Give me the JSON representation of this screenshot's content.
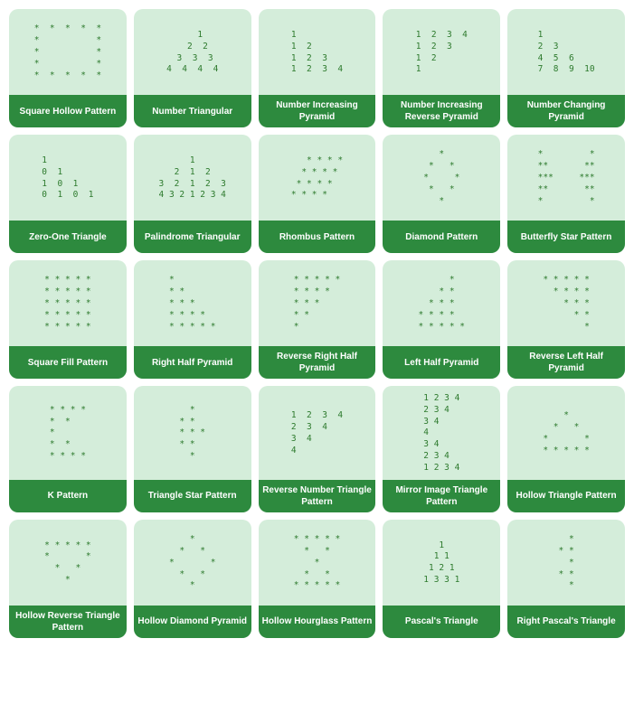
{
  "cards": [
    {
      "label": "Square Hollow\nPattern",
      "content": "*  *  *  *  *\n*              *\n*              *\n*              *\n*  *  *  *  *"
    },
    {
      "label": "Number\nTriangular",
      "content": "        1\n      2  2\n    3  3  3\n  4  4  4  4"
    },
    {
      "label": "Number\nIncreasing\nPyramid",
      "content": "1\n1  2\n1  2  3\n1  2  3  4"
    },
    {
      "label": "Number\nIncreasing\nReverse Pyramid",
      "content": "1  2  3  4\n1  2  3\n1  2\n1"
    },
    {
      "label": "Number\nChanging\nPyramid",
      "content": "1\n2  3\n4  5  6\n7  8  9  10"
    },
    {
      "label": "Zero-One\nTriangle",
      "content": "1\n0  1\n1  0  1\n0  1  0  1"
    },
    {
      "label": "Palindrome\nTriangular",
      "content": "         1\n      2  1  2\n   3  2  1  2  3\n4  3  2  1  2  3  4"
    },
    {
      "label": "Rhombus Pattern",
      "content": "   *  *  *  *\n  *  *  *  *\n *  *  *  *\n*  *  *  *"
    },
    {
      "label": "Diamond Pattern",
      "content": "    *\n  *    *\n*        *\n  *    *\n    *"
    },
    {
      "label": "Butterfly\nStar Pattern",
      "content": "*              *\n* *          * *\n* * *      * * *\n* *          * *\n*              *"
    },
    {
      "label": "Square Fill\nPattern",
      "content": "* * * * *\n* * * * *\n* * * * *\n* * * * *\n* * * * *"
    },
    {
      "label": "Right Half\nPyramid",
      "content": "*\n* *\n* * *\n* * * *\n* * * * *"
    },
    {
      "label": "Reverse Right\nHalf Pyramid",
      "content": "* * * * *\n* * * *\n* * *\n* *\n*"
    },
    {
      "label": "Left Half\nPyramid",
      "content": "        *\n      * *\n    * * *\n  * * * *\n* * * * *"
    },
    {
      "label": "Reverse Left\nHalf Pyramid",
      "content": "* * * * *\n  * * * *\n    * * *\n      * *\n        *"
    },
    {
      "label": "K Pattern",
      "content": "* * * *\n*  *\n*\n*  *\n* * * *"
    },
    {
      "label": "Triangle Star\nPattern",
      "content": "    *\n  * *\n* * *\n  * *\n    *"
    },
    {
      "label": "Reverse Number\nTriangle Pattern",
      "content": "1  2  3  4\n  2  3  4\n    3  4\n      4"
    },
    {
      "label": "Mirror Image\nTriangle Pattern",
      "content": "1  2  3  4\n  2  3  4\n    3  4\n      4\n    3  4\n  2  3  4\n1  2  3  4"
    },
    {
      "label": "Hollow\nTriangle Pattern",
      "content": "    *\n  *   *\n*       *\n* * * * *"
    },
    {
      "label": "Hollow Reverse\nTriangle Pattern",
      "content": "* * * * *\n*       *\n  *   *\n    *"
    },
    {
      "label": "Hollow Diamond\nPyramid",
      "content": "    *\n  *   *\n*       *\n  *   *\n    *"
    },
    {
      "label": "Hollow Hourglass\nPattern",
      "content": "* * * * *\n  *   *\n    *\n  *   *\n* * * * *"
    },
    {
      "label": "Pascal's\nTriangle",
      "content": "    1\n   1 1\n  1 2 1\n 1 3 3 1"
    },
    {
      "label": "Right Pascal's\nTriangle",
      "content": "    *\n  *   *\n*       *\n  *   *\n    *"
    }
  ]
}
